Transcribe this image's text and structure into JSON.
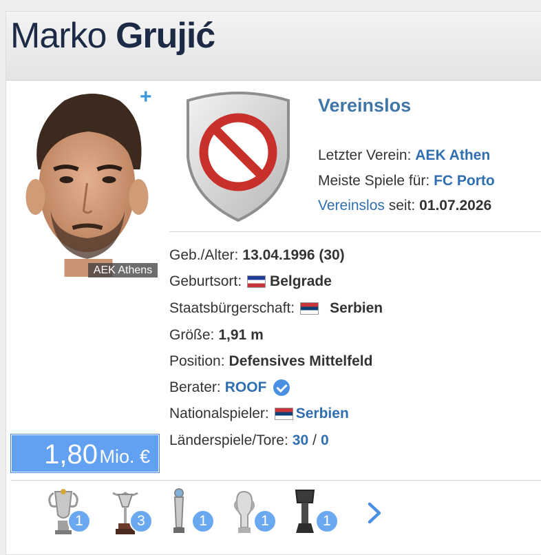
{
  "header": {
    "first_name": "Marko",
    "last_name": "Grujić"
  },
  "photo": {
    "caption": "AEK Athens",
    "add_label": "+"
  },
  "club": {
    "status": "Vereinslos",
    "last_club_label": "Letzter Verein:",
    "last_club": "AEK Athen",
    "most_games_label": "Meiste Spiele für:",
    "most_games_club": "FC Porto",
    "since_link": "Vereinslos",
    "since_label": "seit:",
    "since_date": "01.07.2026"
  },
  "details": {
    "birth_label": "Geb./Alter:",
    "birth_value": "13.04.1996 (30)",
    "birthplace_label": "Geburtsort:",
    "birthplace_value": "Belgrade",
    "citizenship_label": "Staatsbürgerschaft:",
    "citizenship_value": "Serbien",
    "height_label": "Größe:",
    "height_value": "1,91 m",
    "position_label": "Position:",
    "position_value": "Defensives Mittelfeld",
    "agent_label": "Berater:",
    "agent_value": "ROOF",
    "national_label": "Nationalspieler:",
    "national_value": "Serbien",
    "caps_label": "Länderspiele/Tore:",
    "caps_value": "30",
    "caps_sep": "/",
    "goals_value": "0"
  },
  "market_value": {
    "amount": "1,80",
    "unit": "Mio. €"
  },
  "trophies": [
    {
      "icon": "trophy-cup-icon",
      "count": "1"
    },
    {
      "icon": "trophy-stand-icon",
      "count": "3"
    },
    {
      "icon": "trophy-slim-icon",
      "count": "1"
    },
    {
      "icon": "trophy-silver-icon",
      "count": "1"
    },
    {
      "icon": "trophy-dark-icon",
      "count": "1"
    }
  ],
  "colors": {
    "accent": "#2f6fb0",
    "value_box": "#62a0f2",
    "title": "#1d2a46"
  }
}
